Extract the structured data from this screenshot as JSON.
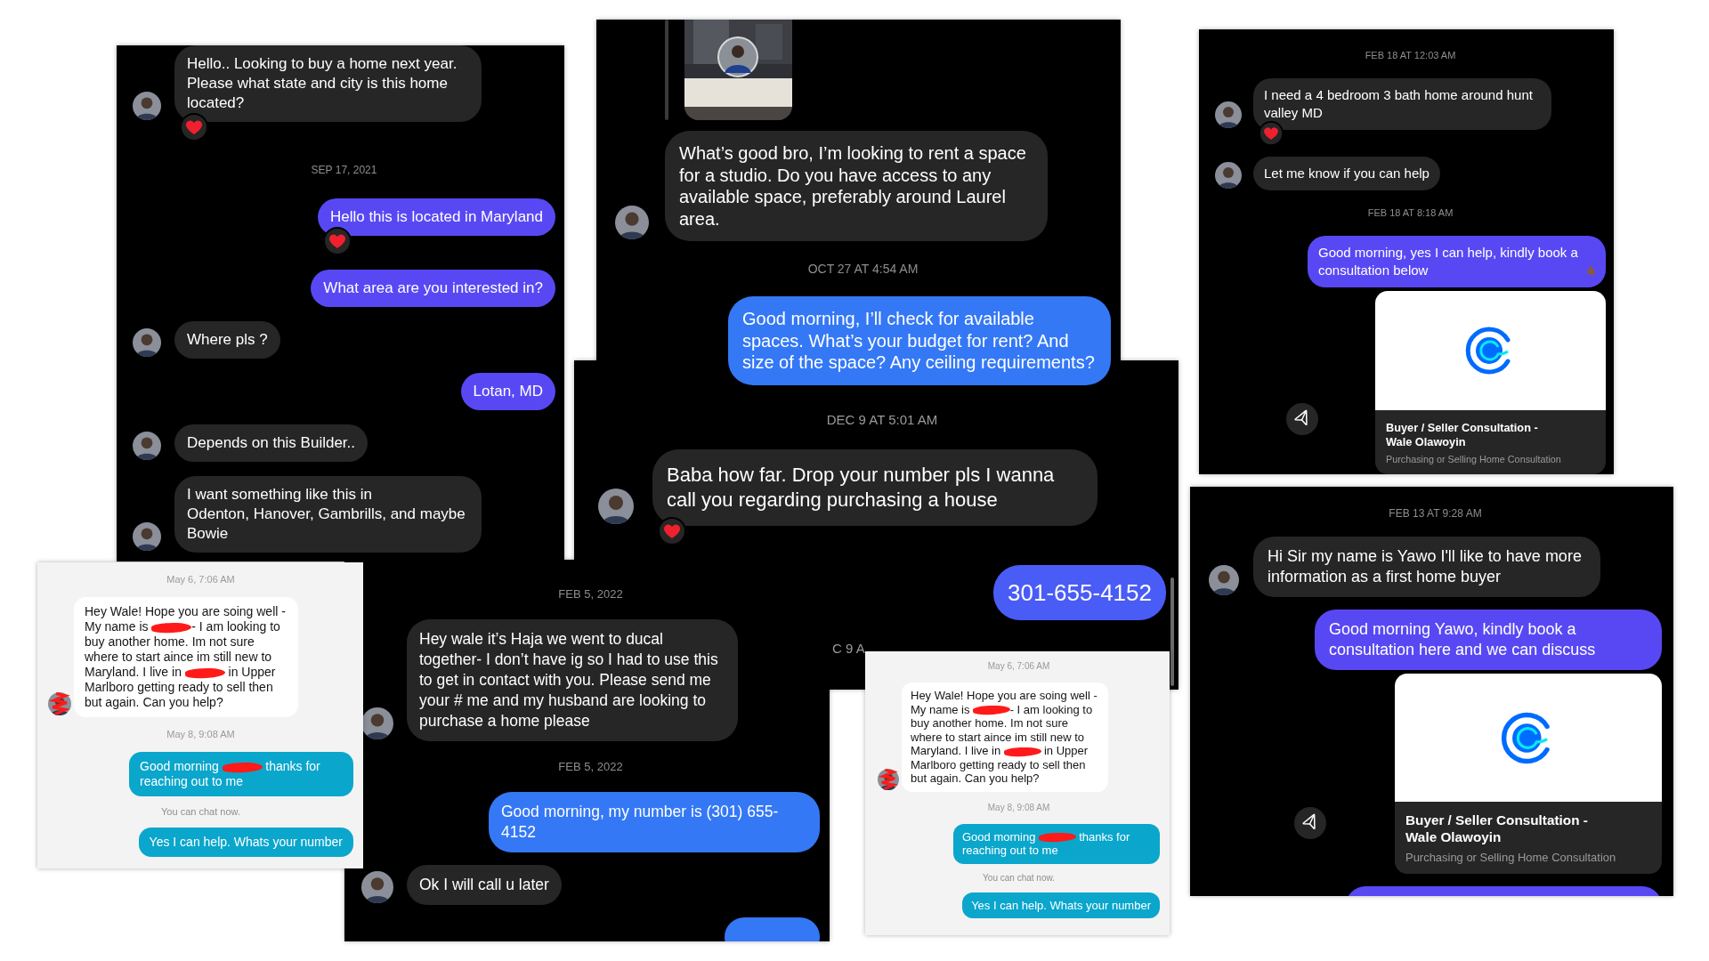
{
  "panels": [
    {
      "items": [
        {
          "kind": "in",
          "text": "Hello.. Looking to buy a home next year. Please what state and city is this home located?",
          "reaction": true
        },
        {
          "kind": "time",
          "text": "SEP 17, 2021"
        },
        {
          "kind": "out",
          "text": "Hello this is located in Maryland",
          "reaction": true
        },
        {
          "kind": "out",
          "text": "What area are you interested in?",
          "reaction": false
        },
        {
          "kind": "in",
          "text": "Where pls ?",
          "reaction": false
        },
        {
          "kind": "out",
          "text": "Lotan, MD",
          "reaction": false
        },
        {
          "kind": "in",
          "text": "Depends on this Builder..",
          "reaction": false
        },
        {
          "kind": "in",
          "text": "I want something like this in\nOdenton, Hanover, Gambrills, and maybe Bowie",
          "reaction": false
        }
      ]
    },
    {
      "items": [
        {
          "kind": "picture"
        },
        {
          "kind": "in",
          "text": "What’s good bro, I’m looking to rent a space for a studio. Do you have access to any available space, preferably around Laurel area.",
          "reaction": false
        },
        {
          "kind": "time",
          "text": "OCT 27 AT 4:54 AM"
        },
        {
          "kind": "out",
          "text": "Good morning, I’ll check for available spaces. What’s your budget for rent? And size of the space? Any ceiling requirements?",
          "reaction": false
        }
      ]
    },
    {
      "items": [
        {
          "kind": "time",
          "text": "FEB 18 AT 12:03 AM"
        },
        {
          "kind": "in",
          "text": "I need a 4 bedroom 3 bath home around hunt valley MD",
          "reaction": true
        },
        {
          "kind": "in",
          "text": "Let me know if you can help",
          "reaction": false
        },
        {
          "kind": "time",
          "text": "FEB 18 AT 8:18 AM"
        },
        {
          "kind": "out",
          "text": "Good morning, yes I can help, kindly book a consultation below",
          "reaction": false,
          "hand_icon": true
        },
        {
          "kind": "card",
          "title": "Buyer / Seller Consultation -\nWale Olawoyin",
          "subtitle": "Purchasing or Selling Home Consultation"
        }
      ]
    },
    {
      "items": [
        {
          "kind": "time",
          "text": "DEC 9 AT 5:01 AM"
        },
        {
          "kind": "in",
          "text": "Baba how far. Drop your number pls I wanna call you regarding purchasing a house",
          "reaction": true
        },
        {
          "kind": "out",
          "text": "301-655-4152",
          "reaction": false
        },
        {
          "kind": "fragment",
          "text": "C 9 A"
        }
      ]
    },
    {
      "items": [
        {
          "kind": "time",
          "text": "FEB 13 AT 9:28 AM"
        },
        {
          "kind": "in",
          "text": "Hi Sir my name is Yawo I'll like to have more information as a first home buyer",
          "reaction": false
        },
        {
          "kind": "out",
          "text": "Good morning Yawo, kindly book a consultation here and we can discuss",
          "reaction": false
        },
        {
          "kind": "card",
          "title": "Buyer / Seller Consultation -\nWale Olawoyin",
          "subtitle": "Purchasing or Selling Home Consultation"
        },
        {
          "kind": "stub"
        }
      ]
    },
    {
      "items": [
        {
          "kind": "time",
          "text": "May 6, 7:06 AM"
        },
        {
          "kind": "in",
          "avatar_redacted": true,
          "segments": [
            {
              "kind": "text",
              "text": "Hey Wale! Hope you are soing well - My name is "
            },
            {
              "kind": "redacted"
            },
            {
              "kind": "text",
              "text": "- I am looking to buy another home. Im not sure where to start aince im still new to Maryland. I live in "
            },
            {
              "kind": "redacted"
            },
            {
              "kind": "text",
              "text": " in Upper Marlboro getting ready to sell then but again. Can you help?"
            }
          ],
          "reaction": false
        },
        {
          "kind": "time",
          "text": "May 8, 9:08 AM"
        },
        {
          "kind": "out",
          "segments": [
            {
              "kind": "text",
              "text": "Good morning "
            },
            {
              "kind": "redacted"
            },
            {
              "kind": "text",
              "text": " thanks for reaching out to me"
            }
          ],
          "reaction": false
        },
        {
          "kind": "note",
          "text": "You can chat now."
        },
        {
          "kind": "out",
          "text": "Yes I can help. Whats your number",
          "reaction": false
        }
      ]
    },
    {
      "items": [
        {
          "kind": "time",
          "text": "FEB 5, 2022"
        },
        {
          "kind": "in",
          "text": "Hey wale it’s Haja we went to ducal together- I don’t have ig so I had to use this to get in contact with you. Please send me your # me and my husband are looking to purchase a home please",
          "reaction": false
        },
        {
          "kind": "time",
          "text": "FEB 5, 2022"
        },
        {
          "kind": "out",
          "text": "Good morning, my number is (301) 655-4152",
          "reaction": false
        },
        {
          "kind": "in",
          "text": "Ok I will call u later",
          "reaction": false
        },
        {
          "kind": "stub"
        }
      ]
    },
    {
      "items": [
        {
          "kind": "time",
          "text": "May 6, 7:06 AM"
        },
        {
          "kind": "in",
          "avatar_redacted": true,
          "segments": [
            {
              "kind": "text",
              "text": "Hey Wale! Hope you are soing well - My name is "
            },
            {
              "kind": "redacted"
            },
            {
              "kind": "text",
              "text": "- I am looking to buy another home. Im not sure where to start aince im still new to Maryland. I live in "
            },
            {
              "kind": "redacted"
            },
            {
              "kind": "text",
              "text": " in Upper Marlboro getting ready to sell then but again. Can you help?"
            }
          ],
          "reaction": false
        },
        {
          "kind": "time",
          "text": "May 8, 9:08 AM"
        },
        {
          "kind": "out",
          "segments": [
            {
              "kind": "text",
              "text": "Good morning "
            },
            {
              "kind": "redacted"
            },
            {
              "kind": "text",
              "text": " thanks for reaching out to me"
            }
          ],
          "reaction": false
        },
        {
          "kind": "note",
          "text": "You can chat now."
        },
        {
          "kind": "out",
          "text": "Yes I can help. Whats your number",
          "reaction": false
        }
      ]
    }
  ]
}
